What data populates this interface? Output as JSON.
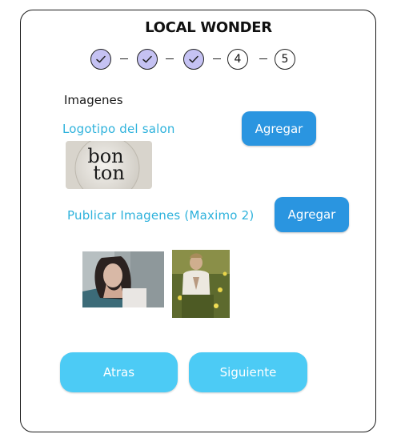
{
  "header": {
    "title": "LOCAL WONDER"
  },
  "stepper": {
    "steps": [
      {
        "label": "",
        "done": true
      },
      {
        "label": "",
        "done": true
      },
      {
        "label": "",
        "done": true
      },
      {
        "label": "4",
        "done": false
      },
      {
        "label": "5",
        "done": false
      }
    ]
  },
  "images_section": {
    "heading": "Imagenes"
  },
  "logo": {
    "label": "Logotipo del salon",
    "add_label": "Agregar",
    "logo_text_line1": "bon",
    "logo_text_line2": "ton"
  },
  "publish": {
    "label": "Publicar Imagenes (Maximo 2)",
    "add_label": "Agregar"
  },
  "footer": {
    "back_label": "Atras",
    "next_label": "Siguiente"
  },
  "colors": {
    "step_done": "#c5c2f3",
    "accent_blue": "#2a95e0",
    "light_blue": "#4ccbf5",
    "label_cyan": "#2eb2dc"
  }
}
